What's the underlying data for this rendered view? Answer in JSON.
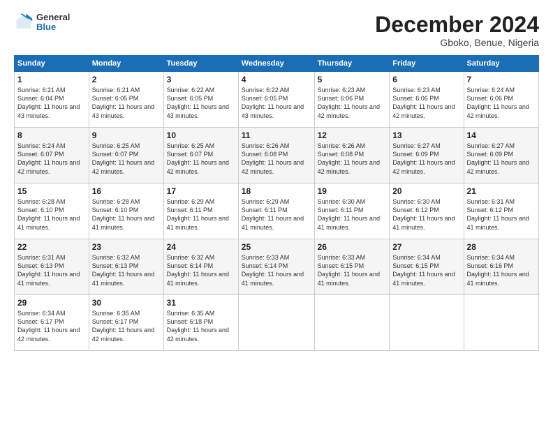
{
  "header": {
    "logo_general": "General",
    "logo_blue": "Blue",
    "month_title": "December 2024",
    "location": "Gboko, Benue, Nigeria"
  },
  "calendar": {
    "days_of_week": [
      "Sunday",
      "Monday",
      "Tuesday",
      "Wednesday",
      "Thursday",
      "Friday",
      "Saturday"
    ],
    "weeks": [
      [
        {
          "day": "1",
          "sunrise": "6:21 AM",
          "sunset": "6:04 PM",
          "daylight": "11 hours and 43 minutes."
        },
        {
          "day": "2",
          "sunrise": "6:21 AM",
          "sunset": "6:05 PM",
          "daylight": "11 hours and 43 minutes."
        },
        {
          "day": "3",
          "sunrise": "6:22 AM",
          "sunset": "6:05 PM",
          "daylight": "11 hours and 43 minutes."
        },
        {
          "day": "4",
          "sunrise": "6:22 AM",
          "sunset": "6:05 PM",
          "daylight": "11 hours and 43 minutes."
        },
        {
          "day": "5",
          "sunrise": "6:23 AM",
          "sunset": "6:06 PM",
          "daylight": "11 hours and 42 minutes."
        },
        {
          "day": "6",
          "sunrise": "6:23 AM",
          "sunset": "6:06 PM",
          "daylight": "11 hours and 42 minutes."
        },
        {
          "day": "7",
          "sunrise": "6:24 AM",
          "sunset": "6:06 PM",
          "daylight": "11 hours and 42 minutes."
        }
      ],
      [
        {
          "day": "8",
          "sunrise": "6:24 AM",
          "sunset": "6:07 PM",
          "daylight": "11 hours and 42 minutes."
        },
        {
          "day": "9",
          "sunrise": "6:25 AM",
          "sunset": "6:07 PM",
          "daylight": "11 hours and 42 minutes."
        },
        {
          "day": "10",
          "sunrise": "6:25 AM",
          "sunset": "6:07 PM",
          "daylight": "11 hours and 42 minutes."
        },
        {
          "day": "11",
          "sunrise": "6:26 AM",
          "sunset": "6:08 PM",
          "daylight": "11 hours and 42 minutes."
        },
        {
          "day": "12",
          "sunrise": "6:26 AM",
          "sunset": "6:08 PM",
          "daylight": "11 hours and 42 minutes."
        },
        {
          "day": "13",
          "sunrise": "6:27 AM",
          "sunset": "6:09 PM",
          "daylight": "11 hours and 42 minutes."
        },
        {
          "day": "14",
          "sunrise": "6:27 AM",
          "sunset": "6:09 PM",
          "daylight": "11 hours and 42 minutes."
        }
      ],
      [
        {
          "day": "15",
          "sunrise": "6:28 AM",
          "sunset": "6:10 PM",
          "daylight": "11 hours and 41 minutes."
        },
        {
          "day": "16",
          "sunrise": "6:28 AM",
          "sunset": "6:10 PM",
          "daylight": "11 hours and 41 minutes."
        },
        {
          "day": "17",
          "sunrise": "6:29 AM",
          "sunset": "6:11 PM",
          "daylight": "11 hours and 41 minutes."
        },
        {
          "day": "18",
          "sunrise": "6:29 AM",
          "sunset": "6:11 PM",
          "daylight": "11 hours and 41 minutes."
        },
        {
          "day": "19",
          "sunrise": "6:30 AM",
          "sunset": "6:11 PM",
          "daylight": "11 hours and 41 minutes."
        },
        {
          "day": "20",
          "sunrise": "6:30 AM",
          "sunset": "6:12 PM",
          "daylight": "11 hours and 41 minutes."
        },
        {
          "day": "21",
          "sunrise": "6:31 AM",
          "sunset": "6:12 PM",
          "daylight": "11 hours and 41 minutes."
        }
      ],
      [
        {
          "day": "22",
          "sunrise": "6:31 AM",
          "sunset": "6:13 PM",
          "daylight": "11 hours and 41 minutes."
        },
        {
          "day": "23",
          "sunrise": "6:32 AM",
          "sunset": "6:13 PM",
          "daylight": "11 hours and 41 minutes."
        },
        {
          "day": "24",
          "sunrise": "6:32 AM",
          "sunset": "6:14 PM",
          "daylight": "11 hours and 41 minutes."
        },
        {
          "day": "25",
          "sunrise": "6:33 AM",
          "sunset": "6:14 PM",
          "daylight": "11 hours and 41 minutes."
        },
        {
          "day": "26",
          "sunrise": "6:33 AM",
          "sunset": "6:15 PM",
          "daylight": "11 hours and 41 minutes."
        },
        {
          "day": "27",
          "sunrise": "6:34 AM",
          "sunset": "6:15 PM",
          "daylight": "11 hours and 41 minutes."
        },
        {
          "day": "28",
          "sunrise": "6:34 AM",
          "sunset": "6:16 PM",
          "daylight": "11 hours and 41 minutes."
        }
      ],
      [
        {
          "day": "29",
          "sunrise": "6:34 AM",
          "sunset": "6:17 PM",
          "daylight": "11 hours and 42 minutes."
        },
        {
          "day": "30",
          "sunrise": "6:35 AM",
          "sunset": "6:17 PM",
          "daylight": "11 hours and 42 minutes."
        },
        {
          "day": "31",
          "sunrise": "6:35 AM",
          "sunset": "6:18 PM",
          "daylight": "11 hours and 42 minutes."
        },
        null,
        null,
        null,
        null
      ]
    ],
    "labels": {
      "sunrise": "Sunrise:",
      "sunset": "Sunset:",
      "daylight": "Daylight:"
    }
  }
}
